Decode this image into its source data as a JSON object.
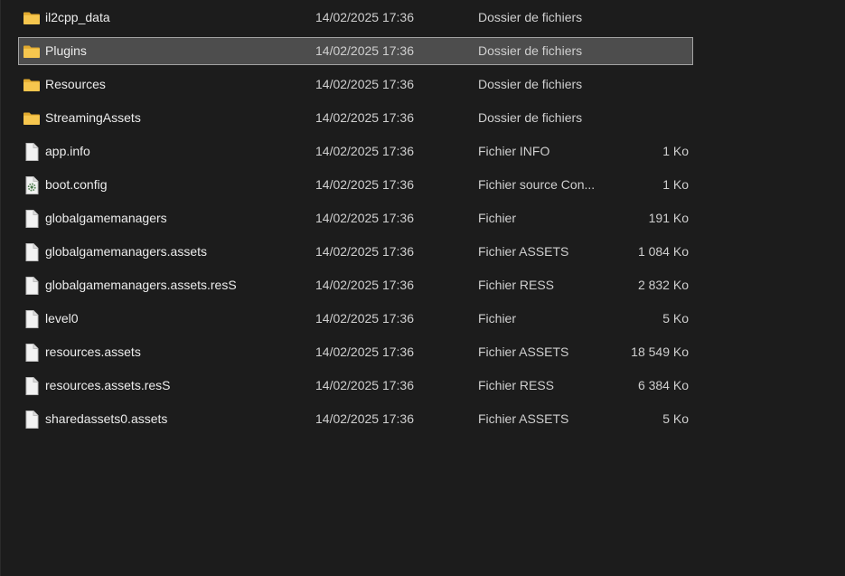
{
  "colors": {
    "background": "#1c1c1c",
    "selection_background": "#4d4d4d",
    "selection_border": "#a3a3a3",
    "folder_yellow": "#f6c64e",
    "file_white": "#f2f2f2"
  },
  "files": [
    {
      "name": "il2cpp_data",
      "date": "14/02/2025 17:36",
      "type": "Dossier de fichiers",
      "size": "",
      "icon": "folder-icon",
      "selected": false
    },
    {
      "name": "Plugins",
      "date": "14/02/2025 17:36",
      "type": "Dossier de fichiers",
      "size": "",
      "icon": "folder-icon",
      "selected": true
    },
    {
      "name": "Resources",
      "date": "14/02/2025 17:36",
      "type": "Dossier de fichiers",
      "size": "",
      "icon": "folder-icon",
      "selected": false
    },
    {
      "name": "StreamingAssets",
      "date": "14/02/2025 17:36",
      "type": "Dossier de fichiers",
      "size": "",
      "icon": "folder-icon",
      "selected": false
    },
    {
      "name": "app.info",
      "date": "14/02/2025 17:36",
      "type": "Fichier INFO",
      "size": "1 Ko",
      "icon": "file-icon",
      "selected": false
    },
    {
      "name": "boot.config",
      "date": "14/02/2025 17:36",
      "type": "Fichier source Con...",
      "size": "1 Ko",
      "icon": "config-file-icon",
      "selected": false
    },
    {
      "name": "globalgamemanagers",
      "date": "14/02/2025 17:36",
      "type": "Fichier",
      "size": "191 Ko",
      "icon": "file-icon",
      "selected": false
    },
    {
      "name": "globalgamemanagers.assets",
      "date": "14/02/2025 17:36",
      "type": "Fichier ASSETS",
      "size": "1 084 Ko",
      "icon": "file-icon",
      "selected": false
    },
    {
      "name": "globalgamemanagers.assets.resS",
      "date": "14/02/2025 17:36",
      "type": "Fichier RESS",
      "size": "2 832 Ko",
      "icon": "file-icon",
      "selected": false
    },
    {
      "name": "level0",
      "date": "14/02/2025 17:36",
      "type": "Fichier",
      "size": "5 Ko",
      "icon": "file-icon",
      "selected": false
    },
    {
      "name": "resources.assets",
      "date": "14/02/2025 17:36",
      "type": "Fichier ASSETS",
      "size": "18 549 Ko",
      "icon": "file-icon",
      "selected": false
    },
    {
      "name": "resources.assets.resS",
      "date": "14/02/2025 17:36",
      "type": "Fichier RESS",
      "size": "6 384 Ko",
      "icon": "file-icon",
      "selected": false
    },
    {
      "name": "sharedassets0.assets",
      "date": "14/02/2025 17:36",
      "type": "Fichier ASSETS",
      "size": "5 Ko",
      "icon": "file-icon",
      "selected": false
    }
  ]
}
